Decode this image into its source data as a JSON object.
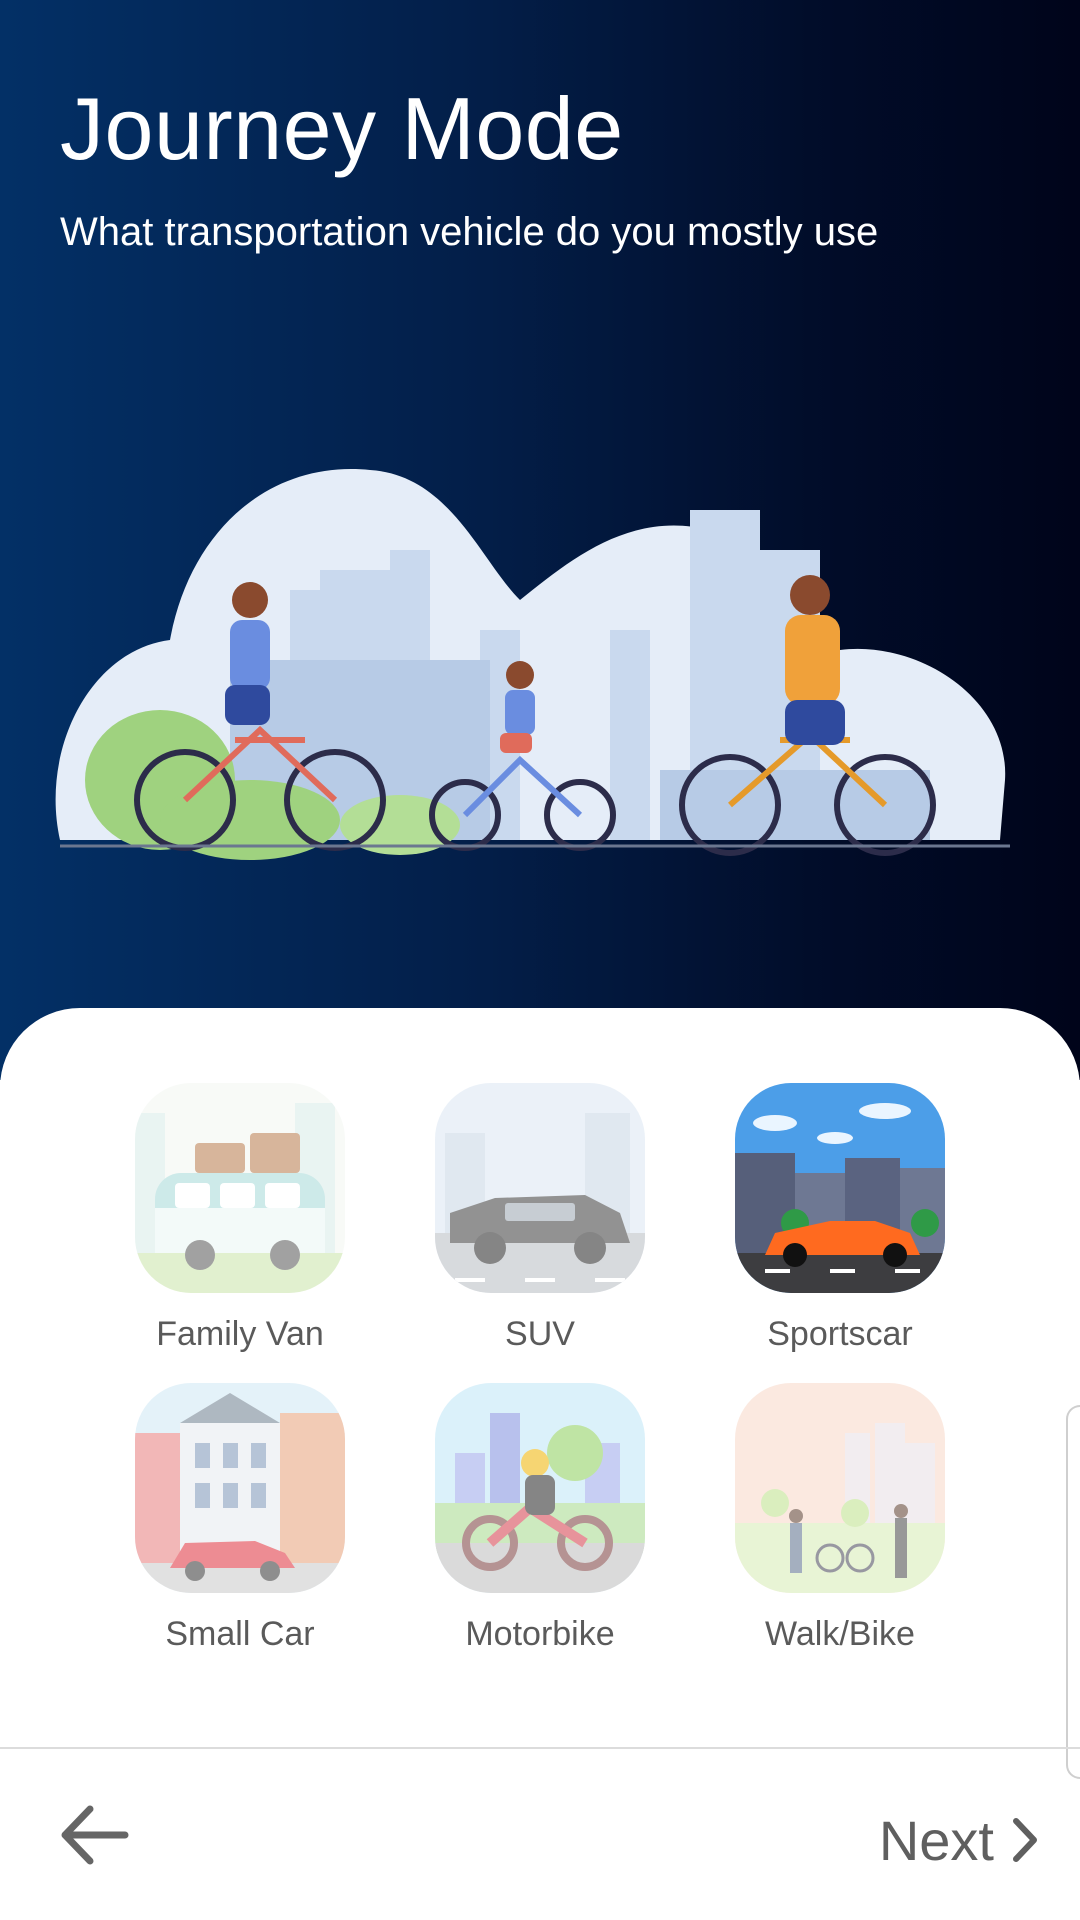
{
  "header": {
    "title": "Journey Mode",
    "subtitle": "What transportation vehicle do you mostly use"
  },
  "colors": {
    "gradient_start": "#033066",
    "gradient_end": "#00041a",
    "label_text": "#5a5a5a"
  },
  "options": [
    {
      "label": "Family Van",
      "selected": false
    },
    {
      "label": "SUV",
      "selected": false
    },
    {
      "label": "Sportscar",
      "selected": true
    },
    {
      "label": "Small Car",
      "selected": false
    },
    {
      "label": "Motorbike",
      "selected": false
    },
    {
      "label": "Walk/Bike",
      "selected": false
    }
  ],
  "footer": {
    "back_icon": "arrow-left-icon",
    "next_label": "Next",
    "next_icon": "chevron-right-icon"
  }
}
